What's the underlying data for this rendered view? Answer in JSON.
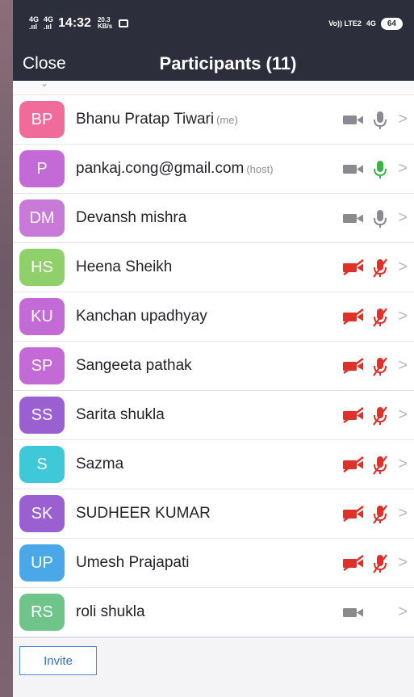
{
  "status_bar": {
    "signal_1": "4G",
    "signal_2": "4G",
    "time": "14:32",
    "speed": "20.3",
    "speed_unit": "KB/s",
    "right_network": "Vo)) LTE2",
    "right_4g": "4G",
    "battery": "64"
  },
  "header": {
    "close_label": "Close",
    "title": "Participants (11)"
  },
  "participants": [
    {
      "initials": "BP",
      "name": "Bhanu Pratap Tiwari",
      "tag": "(me)",
      "color": "#f06b9a",
      "video": "on",
      "mic": "on",
      "mic_active": false
    },
    {
      "initials": "P",
      "name": "pankaj.cong@gmail.com",
      "tag": "(host)",
      "color": "#c46ad6",
      "video": "on",
      "mic": "on",
      "mic_active": true
    },
    {
      "initials": "DM",
      "name": "Devansh mishra",
      "tag": "",
      "color": "#c77ad8",
      "video": "on",
      "mic": "on",
      "mic_active": false
    },
    {
      "initials": "HS",
      "name": "Heena Sheikh",
      "tag": "",
      "color": "#8fd06a",
      "video": "off",
      "mic": "off",
      "mic_active": false
    },
    {
      "initials": "KU",
      "name": "Kanchan upadhyay",
      "tag": "",
      "color": "#c46ad6",
      "video": "off",
      "mic": "off",
      "mic_active": false
    },
    {
      "initials": "SP",
      "name": "Sangeeta pathak",
      "tag": "",
      "color": "#c46ad6",
      "video": "off",
      "mic": "off",
      "mic_active": false
    },
    {
      "initials": "SS",
      "name": "Sarita shukla",
      "tag": "",
      "color": "#9a5fd0",
      "video": "off",
      "mic": "off",
      "mic_active": false
    },
    {
      "initials": "S",
      "name": "Sazma",
      "tag": "",
      "color": "#3fc8d8",
      "video": "off",
      "mic": "off",
      "mic_active": false
    },
    {
      "initials": "SK",
      "name": "SUDHEER KUMAR",
      "tag": "",
      "color": "#9a5fd0",
      "video": "off",
      "mic": "off",
      "mic_active": false
    },
    {
      "initials": "UP",
      "name": "Umesh Prajapati",
      "tag": "",
      "color": "#4aa8e8",
      "video": "off",
      "mic": "off",
      "mic_active": false
    },
    {
      "initials": "RS",
      "name": "roli shukla",
      "tag": "",
      "color": "#6fc48a",
      "video": "on",
      "mic": "none",
      "mic_active": false
    }
  ],
  "footer": {
    "invite_label": "Invite"
  },
  "colors": {
    "header_bg": "#2c2f3b",
    "muted_red": "#e0302a",
    "active_green": "#3bb54a",
    "icon_grey": "#8a8a90"
  }
}
